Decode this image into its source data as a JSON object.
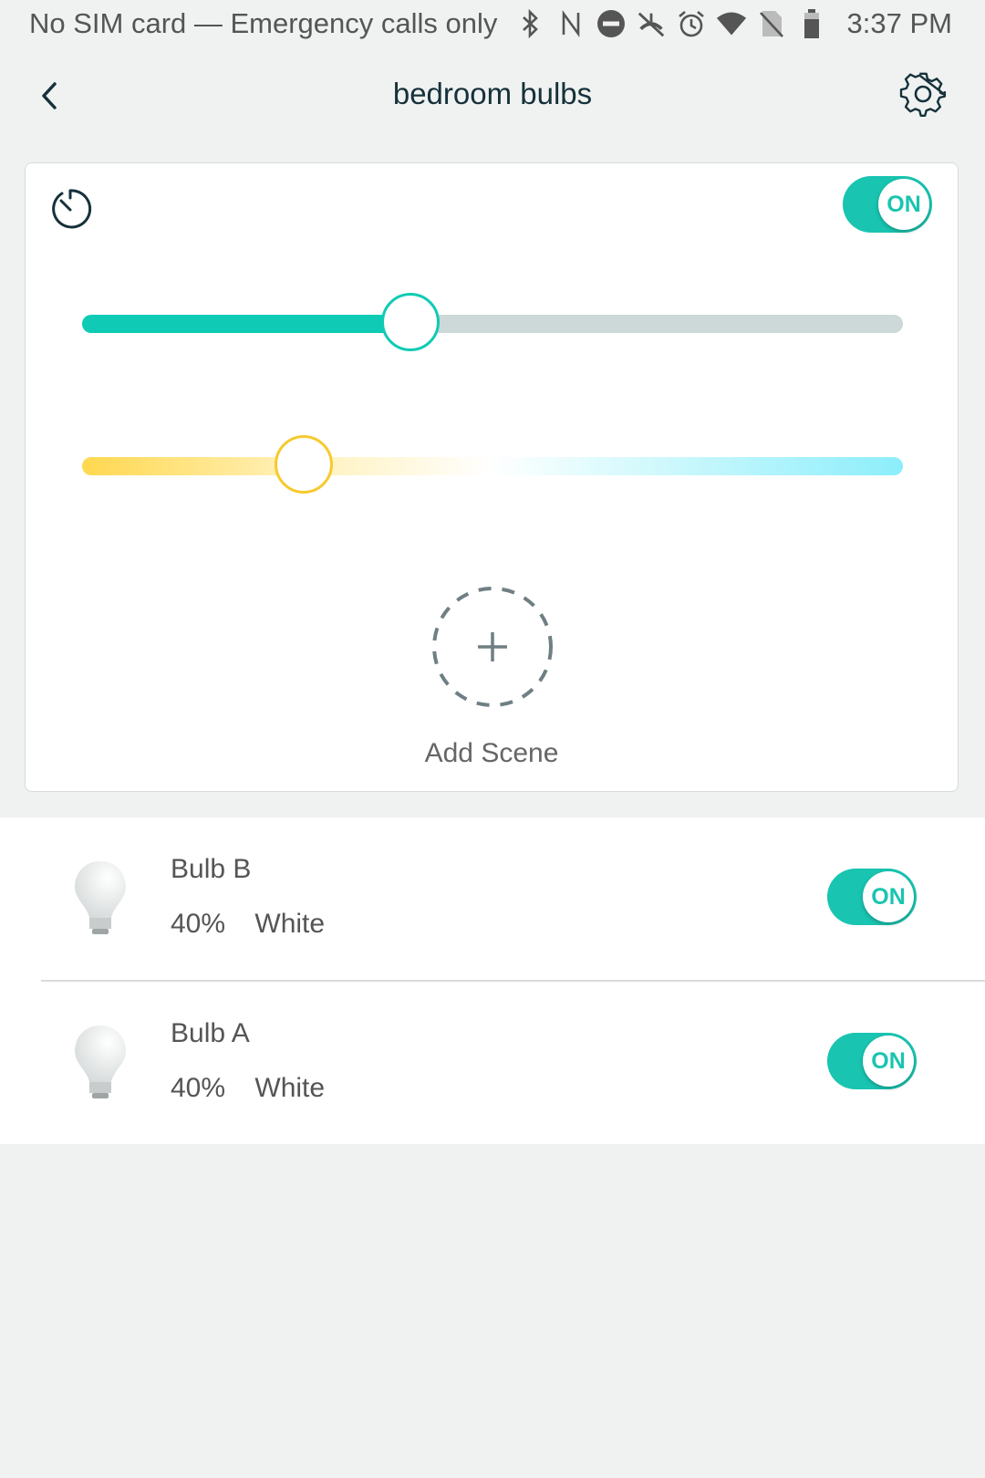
{
  "status_bar": {
    "carrier": "No SIM card — Emergency calls only",
    "time": "3:37 PM",
    "icons": [
      "bluetooth-icon",
      "nfc-icon",
      "do-not-disturb-icon",
      "no-data-icon",
      "alarm-icon",
      "wifi-icon",
      "no-sim-icon",
      "battery-icon"
    ]
  },
  "header": {
    "title": "bedroom bulbs"
  },
  "group_control": {
    "power_label": "ON",
    "power_on": true,
    "brightness_percent": 40,
    "color_temperature_position": 0.27,
    "add_scene_label": "Add Scene"
  },
  "devices": [
    {
      "name": "Bulb B",
      "brightness": "40%",
      "mode": "White",
      "toggle_label": "ON"
    },
    {
      "name": "Bulb A",
      "brightness": "40%",
      "mode": "White",
      "toggle_label": "ON"
    }
  ],
  "colors": {
    "accent": "#19c4b1",
    "warm": "#ffd84f",
    "cool": "#8ceefb",
    "title": "#16313a"
  }
}
